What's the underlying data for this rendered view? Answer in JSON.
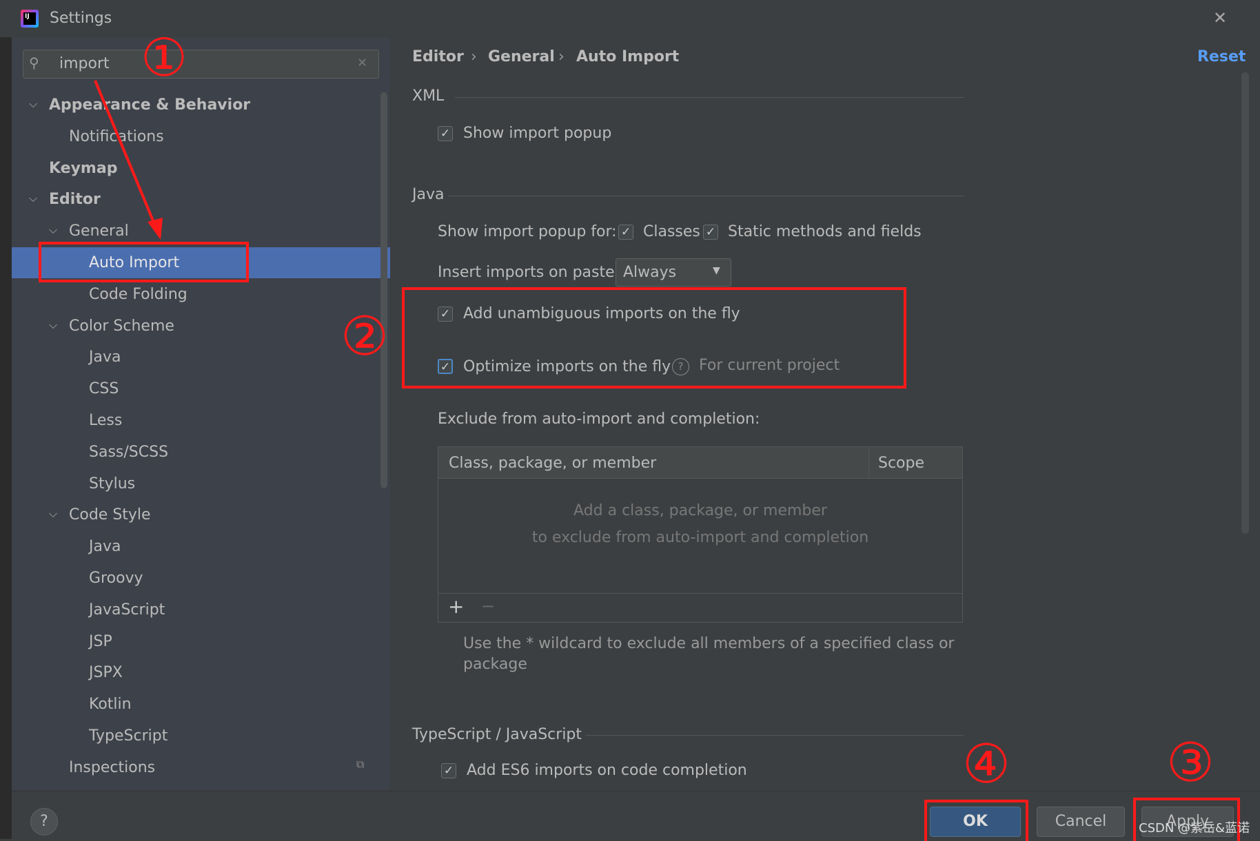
{
  "window": {
    "title": "Settings",
    "close": "✕"
  },
  "search": {
    "value": "import",
    "clear": "✕"
  },
  "tree": [
    {
      "label": "Appearance & Behavior",
      "level": 0,
      "bold": true,
      "expanded": true
    },
    {
      "label": "Notifications",
      "level": 1
    },
    {
      "label": "Keymap",
      "level": 0,
      "bold": true
    },
    {
      "label": "Editor",
      "level": 0,
      "bold": true,
      "expanded": true
    },
    {
      "label": "General",
      "level": 1,
      "expanded": true
    },
    {
      "label": "Auto Import",
      "level": 2,
      "selected": true
    },
    {
      "label": "Code Folding",
      "level": 2
    },
    {
      "label": "Color Scheme",
      "level": 1,
      "expanded": true
    },
    {
      "label": "Java",
      "level": 2
    },
    {
      "label": "CSS",
      "level": 2
    },
    {
      "label": "Less",
      "level": 2
    },
    {
      "label": "Sass/SCSS",
      "level": 2
    },
    {
      "label": "Stylus",
      "level": 2
    },
    {
      "label": "Code Style",
      "level": 1,
      "expanded": true
    },
    {
      "label": "Java",
      "level": 2
    },
    {
      "label": "Groovy",
      "level": 2
    },
    {
      "label": "JavaScript",
      "level": 2
    },
    {
      "label": "JSP",
      "level": 2
    },
    {
      "label": "JSPX",
      "level": 2
    },
    {
      "label": "Kotlin",
      "level": 2
    },
    {
      "label": "TypeScript",
      "level": 2
    },
    {
      "label": "Inspections",
      "level": 1
    }
  ],
  "breadcrumb": [
    "Editor",
    "General",
    "Auto Import"
  ],
  "reset": "Reset",
  "xml": {
    "title": "XML",
    "show_popup": "Show import popup",
    "show_popup_checked": true
  },
  "java": {
    "title": "Java",
    "popup_for": "Show import popup for:",
    "classes": "Classes",
    "static": "Static methods and fields",
    "insert_label": "Insert imports on paste:",
    "insert_value": "Always",
    "add_unambiguous": "Add unambiguous imports on the fly",
    "optimize": "Optimize imports on the fly",
    "optimize_scope": "For current project",
    "exclude_label": "Exclude from auto-import and completion:"
  },
  "table": {
    "col1": "Class, package, or member",
    "col2": "Scope",
    "empty1": "Add a class, package, or member",
    "empty2": "to exclude from auto-import and completion",
    "add": "+",
    "remove": "−"
  },
  "hint": {
    "line1": "Use the * wildcard to exclude all members of a specified class or",
    "line2": "package"
  },
  "ts": {
    "title": "TypeScript / JavaScript",
    "es6": "Add ES6 imports on code completion"
  },
  "footer": {
    "help": "?",
    "ok": "OK",
    "cancel": "Cancel",
    "apply": "Apply"
  },
  "annotations": {
    "n1": "①",
    "n2": "②",
    "n3": "③",
    "n4": "④",
    "watermark": "CSDN @紫岳&蓝诺"
  },
  "colors": {
    "selection": "#4b6eaf",
    "annotation": "#ff1a1a",
    "link": "#589df6"
  }
}
